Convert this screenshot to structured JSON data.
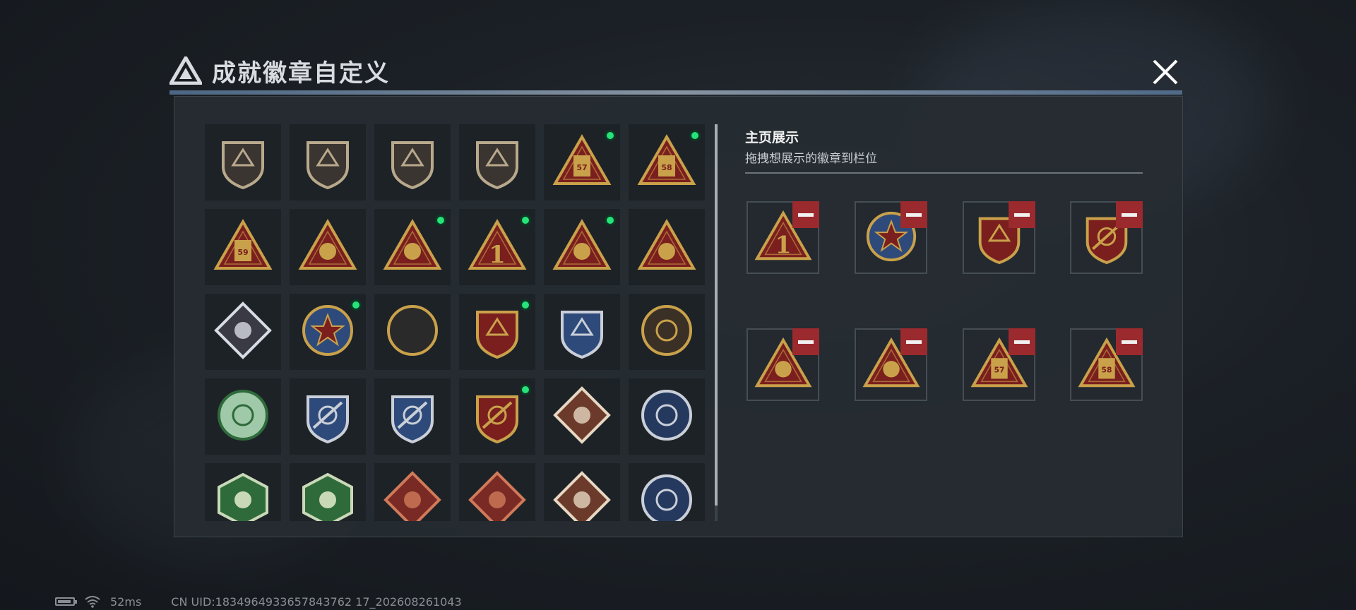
{
  "dialog": {
    "title": "成就徽章自定义",
    "close_icon": "close-icon"
  },
  "colors": {
    "gold": "#c9a14a",
    "dark_red": "#7a1f1e",
    "green_dot": "#28e27a",
    "remove_red": "#9b2a2e"
  },
  "badge_grid": {
    "badges": [
      {
        "icon": "triangle-logo-shield-badge-icon",
        "new": false
      },
      {
        "icon": "helicopter-shield-badge-icon",
        "new": false
      },
      {
        "icon": "diamond-emblem-shield-badge-icon",
        "new": false
      },
      {
        "icon": "dagger-shield-badge-icon",
        "new": false
      },
      {
        "icon": "canister-57-triangle-badge-icon",
        "new": true
      },
      {
        "icon": "canister-58-triangle-badge-icon",
        "new": true
      },
      {
        "icon": "canister-59-triangle-badge-icon",
        "new": false
      },
      {
        "icon": "explosion-triangle-badge-icon",
        "new": false
      },
      {
        "icon": "hands-bowl-triangle-badge-icon",
        "new": true
      },
      {
        "icon": "number-one-triangle-badge-icon",
        "new": true
      },
      {
        "icon": "hands-heart-triangle-badge-icon",
        "new": true
      },
      {
        "icon": "soldiers-triangle-badge-icon",
        "new": false
      },
      {
        "icon": "fist-diamond-badge-icon",
        "new": false
      },
      {
        "icon": "star-round-medal-badge-icon",
        "new": true
      },
      {
        "icon": "emblem-shield-gold-badge-icon",
        "new": false
      },
      {
        "icon": "ribbon-stars-shield-badge-icon",
        "new": true
      },
      {
        "icon": "diamond-blue-shield-badge-icon",
        "new": false
      },
      {
        "icon": "sniper-scope-round-badge-icon",
        "new": false
      },
      {
        "icon": "crosshair-green-round-badge-icon",
        "new": false
      },
      {
        "icon": "rifle-crosshair-blue-shield-badge-icon",
        "new": false
      },
      {
        "icon": "rifle-crosshair-blue-shield-badge-icon",
        "new": false
      },
      {
        "icon": "rifle-crosshair-gold-shield-badge-icon",
        "new": true
      },
      {
        "icon": "wolf-diamond-badge-icon",
        "new": false
      },
      {
        "icon": "eagle-round-badge-icon",
        "new": false
      },
      {
        "icon": "wasp-hexagon-badge-icon",
        "new": false
      },
      {
        "icon": "hammer-hexagon-badge-icon",
        "new": false
      },
      {
        "icon": "dragon-red-diamond-badge-icon",
        "new": false
      },
      {
        "icon": "dragon-red-diamond-badge-icon",
        "new": false
      },
      {
        "icon": "runner-diamond-badge-icon",
        "new": false
      },
      {
        "icon": "wolf-round-badge-icon",
        "new": false
      }
    ]
  },
  "showcase": {
    "title": "主页展示",
    "subtitle": "拖拽想展示的徽章到栏位",
    "remove_icon": "minus-icon",
    "slots": [
      {
        "icon": "number-one-triangle-badge-icon"
      },
      {
        "icon": "star-round-medal-badge-icon"
      },
      {
        "icon": "ribbon-stars-shield-badge-icon"
      },
      {
        "icon": "rifle-crosshair-gold-shield-badge-icon"
      },
      {
        "icon": "hands-heart-triangle-badge-icon"
      },
      {
        "icon": "hands-bowl-triangle-badge-icon"
      },
      {
        "icon": "canister-57-triangle-badge-icon"
      },
      {
        "icon": "canister-58-triangle-badge-icon"
      }
    ]
  },
  "status": {
    "battery_icon": "battery-icon",
    "wifi_icon": "wifi-icon",
    "ping": "52ms",
    "uid": "CN UID:1834964933657843762 17_202608261043"
  }
}
